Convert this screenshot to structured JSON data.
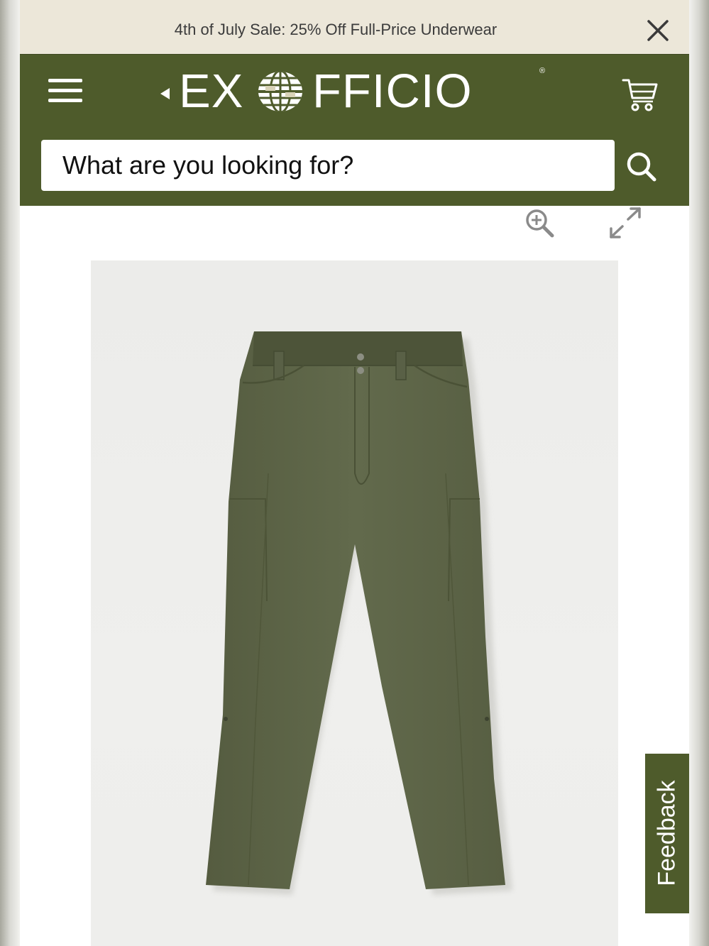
{
  "promo": {
    "text": "4th of July Sale: 25% Off Full-Price Underwear",
    "close_icon": "close-icon"
  },
  "header": {
    "menu_icon": "hamburger-menu-icon",
    "logo": {
      "left": "EX",
      "right": "FFICIO",
      "mark": "®"
    },
    "cart_icon": "shopping-cart-icon",
    "search": {
      "placeholder": "What are you looking for?",
      "value": "",
      "icon": "search-icon"
    }
  },
  "gallery": {
    "zoom_icon": "zoom-in-icon",
    "expand_icon": "expand-icon",
    "product_image": "olive-green-womens-pants"
  },
  "feedback": {
    "label": "Feedback"
  },
  "colors": {
    "brand_olive": "#4e5b2b",
    "promo_background": "#ece7d9",
    "product_olive": "#5d6448"
  }
}
